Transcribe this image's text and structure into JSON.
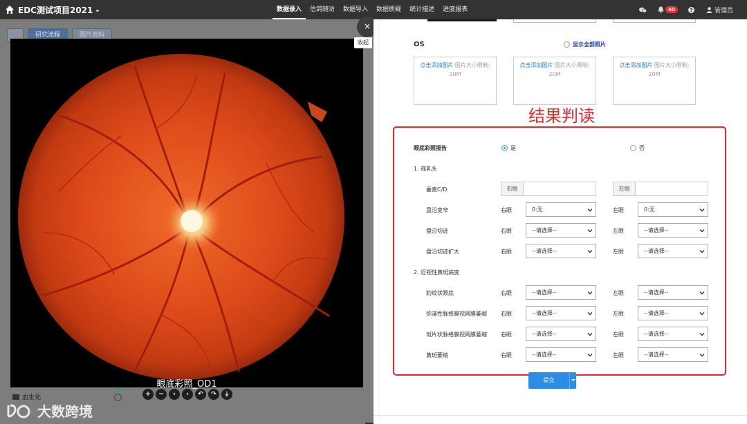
{
  "app": {
    "title": "EDC测试项目2021 -"
  },
  "nav": {
    "items": [
      {
        "label": "数据录入",
        "active": true
      },
      {
        "label": "信鸽随访",
        "active": false
      },
      {
        "label": "数据导入",
        "active": false
      },
      {
        "label": "数据质疑",
        "active": false
      },
      {
        "label": "统计描述",
        "active": false
      },
      {
        "label": "进度报表",
        "active": false
      }
    ]
  },
  "header_right": {
    "notification_count": "40",
    "user": "管理员"
  },
  "left_panel": {
    "tabs": [
      "研究流程",
      "图片资料"
    ],
    "list_items": [
      {
        "label": "血生化"
      }
    ]
  },
  "viewer": {
    "caption": "眼底彩照_OD1",
    "collapse_label": "收起",
    "close_glyph": "×",
    "tools": [
      "+",
      "−",
      "‹",
      "›",
      "↶",
      "↷",
      "⤓"
    ]
  },
  "watermark": {
    "text": "大数跨境"
  },
  "images_section": {
    "os_label": "OS",
    "show_all": "显示全部照片",
    "upload_link": "点击添加图片",
    "upload_hint": "图片大小限制: 20M"
  },
  "annotation": {
    "title": "结果判读"
  },
  "form": {
    "report_label": "眼底彩照报告",
    "yes_label": "是",
    "no_label": "否",
    "report_value": "是",
    "section1": "1. 视乳头",
    "section2": "2. 近视性黄斑病变",
    "right_eye": "右眼",
    "left_eye": "左眼",
    "placeholder": "--请选择--",
    "rows": [
      {
        "label": "垂直C/D",
        "type": "input",
        "right": "",
        "left": ""
      },
      {
        "label": "盘沿变窄",
        "type": "select",
        "right": "0:无",
        "left": "0:无"
      },
      {
        "label": "盘沿切迹",
        "type": "select",
        "right": "--请选择--",
        "left": "--请选择--"
      },
      {
        "label": "盘沿切迹扩大",
        "type": "select",
        "right": "--请选择--",
        "left": "--请选择--"
      },
      {
        "label": "豹纹状眼底",
        "type": "select",
        "right": "--请选择--",
        "left": "--请选择--"
      },
      {
        "label": "弥漫性脉络膜视网膜萎缩",
        "type": "select",
        "right": "--请选择--",
        "left": "--请选择--"
      },
      {
        "label": "斑片状脉络膜视网膜萎缩",
        "type": "select",
        "right": "--请选择--",
        "left": "--请选择--"
      },
      {
        "label": "黄斑萎缩",
        "type": "select",
        "right": "--请选择--",
        "left": "--请选择--"
      }
    ],
    "submit_label": "提交"
  },
  "colors": {
    "accent": "#2b8de6",
    "annotation": "#e8262b",
    "topbar": "#333333"
  }
}
